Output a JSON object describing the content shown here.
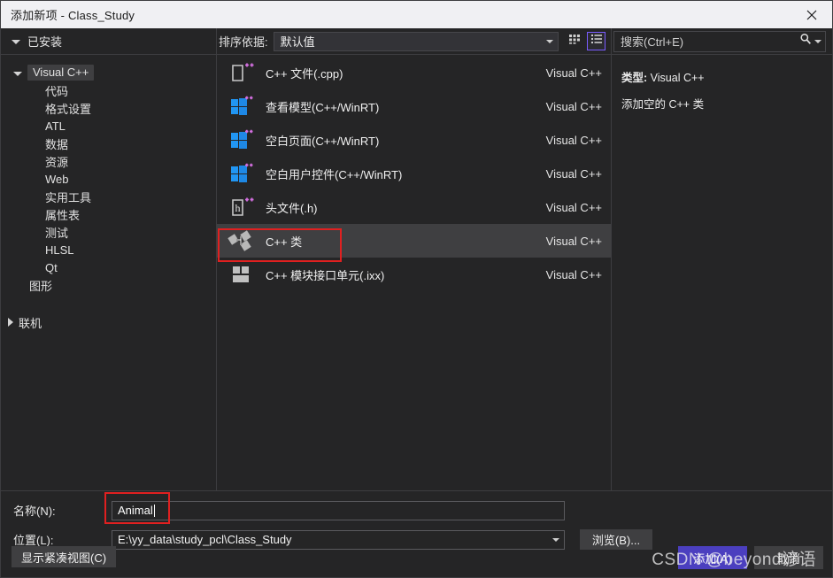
{
  "window": {
    "title": "添加新项 - Class_Study",
    "close_icon": "close-icon"
  },
  "left_panel": {
    "header_label": "已安装",
    "tree": [
      {
        "label": "Visual C++",
        "level": 0,
        "expanded": true,
        "selected": true
      },
      {
        "label": "代码",
        "level": 2
      },
      {
        "label": "格式设置",
        "level": 2
      },
      {
        "label": "ATL",
        "level": 2
      },
      {
        "label": "数据",
        "level": 2
      },
      {
        "label": "资源",
        "level": 2
      },
      {
        "label": "Web",
        "level": 2
      },
      {
        "label": "实用工具",
        "level": 2
      },
      {
        "label": "属性表",
        "level": 2
      },
      {
        "label": "测试",
        "level": 2
      },
      {
        "label": "HLSL",
        "level": 2
      },
      {
        "label": "Qt",
        "level": 2
      },
      {
        "label": "图形",
        "level": 1
      }
    ],
    "online_label": "联机"
  },
  "middle_panel": {
    "sort_label": "排序依据:",
    "sort_value": "默认值",
    "view_grid_icon": "grid-view-icon",
    "view_list_icon": "list-view-icon",
    "active_view": "list",
    "templates": [
      {
        "name": "C++ 文件(.cpp)",
        "lang": "Visual C++",
        "icon": "cpp-file-icon",
        "selected": false
      },
      {
        "name": "查看模型(C++/WinRT)",
        "lang": "Visual C++",
        "icon": "winrt-icon",
        "selected": false
      },
      {
        "name": "空白页面(C++/WinRT)",
        "lang": "Visual C++",
        "icon": "winrt-icon",
        "selected": false
      },
      {
        "name": "空白用户控件(C++/WinRT)",
        "lang": "Visual C++",
        "icon": "winrt-icon",
        "selected": false
      },
      {
        "name": "头文件(.h)",
        "lang": "Visual C++",
        "icon": "header-file-icon",
        "selected": false
      },
      {
        "name": "C++ 类",
        "lang": "Visual C++",
        "icon": "cpp-class-icon",
        "selected": true
      },
      {
        "name": "C++ 模块接口单元(.ixx)",
        "lang": "Visual C++",
        "icon": "cpp-module-icon",
        "selected": false
      }
    ]
  },
  "right_panel": {
    "search_placeholder": "搜索(Ctrl+E)",
    "search_icon": "search-icon",
    "search_dropdown_icon": "chevron-down-icon",
    "detail_type_label": "类型:",
    "detail_type_value": "Visual C++",
    "detail_description": "添加空的 C++ 类"
  },
  "form": {
    "name_label": "名称(N):",
    "name_value": "Animal",
    "location_label": "位置(L):",
    "location_value": "E:\\yy_data\\study_pcl\\Class_Study",
    "browse_button": "浏览(B)...",
    "compact_button": "显示紧凑视图(C)",
    "add_button": "添加(A)",
    "cancel_button": "取消"
  },
  "watermark": {
    "text": "CSDN @beyond谚语"
  },
  "colors": {
    "accent": "#4b3fbf",
    "annotation": "#e02020",
    "background": "#252526",
    "selection": "#3f3f41",
    "titlebar": "#f0f0f3"
  }
}
